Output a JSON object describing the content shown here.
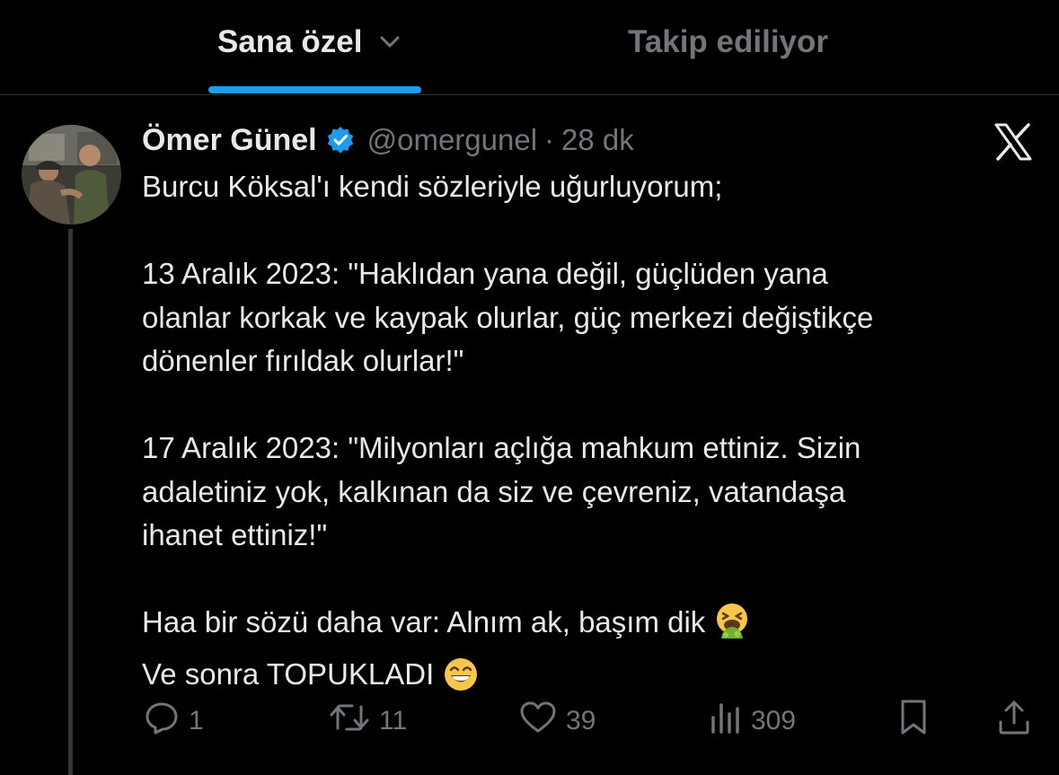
{
  "tabs": [
    {
      "label": "Sana özel",
      "active": true
    },
    {
      "label": "Takip ediliyor",
      "active": false
    }
  ],
  "tweet": {
    "author_name": "Ömer Günel",
    "handle": "@omergunel",
    "separator": "·",
    "time": "28 dk",
    "verified": true,
    "lines": [
      "Burcu Köksal'ı kendi sözleriyle uğurluyorum;",
      "13 Aralık 2023: \"Haklıdan yana değil, güçlüden yana",
      "olanlar korkak ve kaypak olurlar, güç merkezi değiştikçe",
      "dönenler fırıldak olurlar!\"",
      "17 Aralık 2023: \"Milyonları açlığa mahkum ettiniz. Sizin",
      "adaletiniz yok, kalkınan da siz ve çevreniz, vatandaşa",
      "ihanet ettiniz!\"",
      "Haa bir sözü daha var: Alnım ak, başım dik",
      "Ve sonra TOPUKLADI"
    ]
  },
  "actions": {
    "replies": "1",
    "retweets": "11",
    "likes": "39",
    "views": "309"
  },
  "icons": {
    "verified": "verified-badge-icon",
    "x_logo": "x-logo-icon",
    "emoji_1": "vomiting-face-emoji",
    "emoji_2": "grinning-face-emoji"
  },
  "colors": {
    "accent": "#1d9bf0",
    "background": "#000000",
    "text": "#e7e9ea",
    "muted": "#71767b"
  }
}
